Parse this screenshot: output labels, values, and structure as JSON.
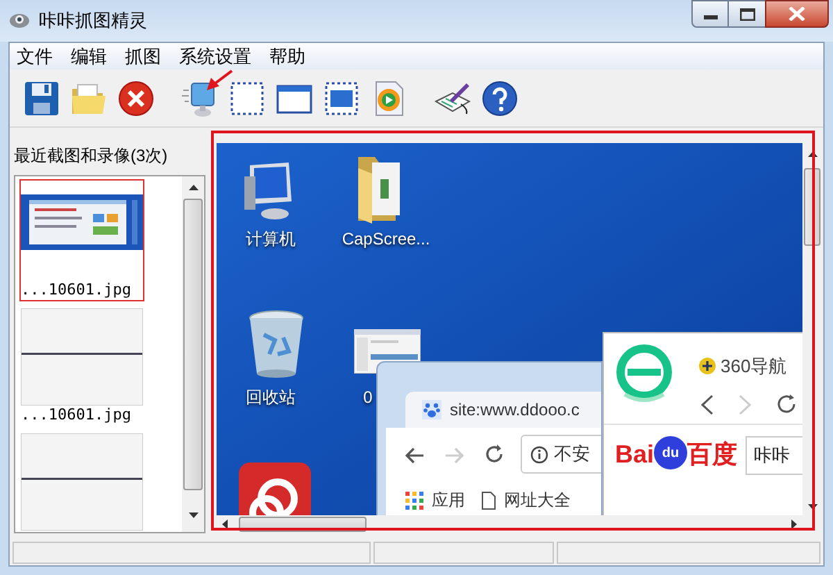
{
  "window": {
    "title": "咔咔抓图精灵"
  },
  "menu": [
    "文件",
    "编辑",
    "抓图",
    "系统设置",
    "帮助"
  ],
  "recent": {
    "title": "最近截图和录像(3次)",
    "items": [
      {
        "label": "...10601.jpg",
        "selected": true,
        "kind": "desktop"
      },
      {
        "label": "...10601.jpg",
        "selected": false,
        "kind": "blank"
      },
      {
        "selected": false,
        "kind": "blank"
      }
    ]
  },
  "preview": {
    "desktop_icons": [
      {
        "label": "计算机",
        "kind": "computer"
      },
      {
        "label": "CapScree...",
        "kind": "folder"
      },
      {
        "label": "回收站",
        "kind": "recycle_bin"
      },
      {
        "label": "0",
        "kind": "document"
      },
      {
        "kind": "app"
      }
    ],
    "back_browser": {
      "tab_title": "site:www.ddooo.c",
      "address": "不安",
      "bookmarks": [
        {
          "label": "应用",
          "kind": "apps"
        },
        {
          "label": "网址大全",
          "kind": "page"
        }
      ]
    },
    "front_browser": {
      "tab_title": "360导航",
      "logo_text": "Bai",
      "logo_mark": "du",
      "logo_cn": "百度",
      "search_value": "咔咔"
    }
  }
}
